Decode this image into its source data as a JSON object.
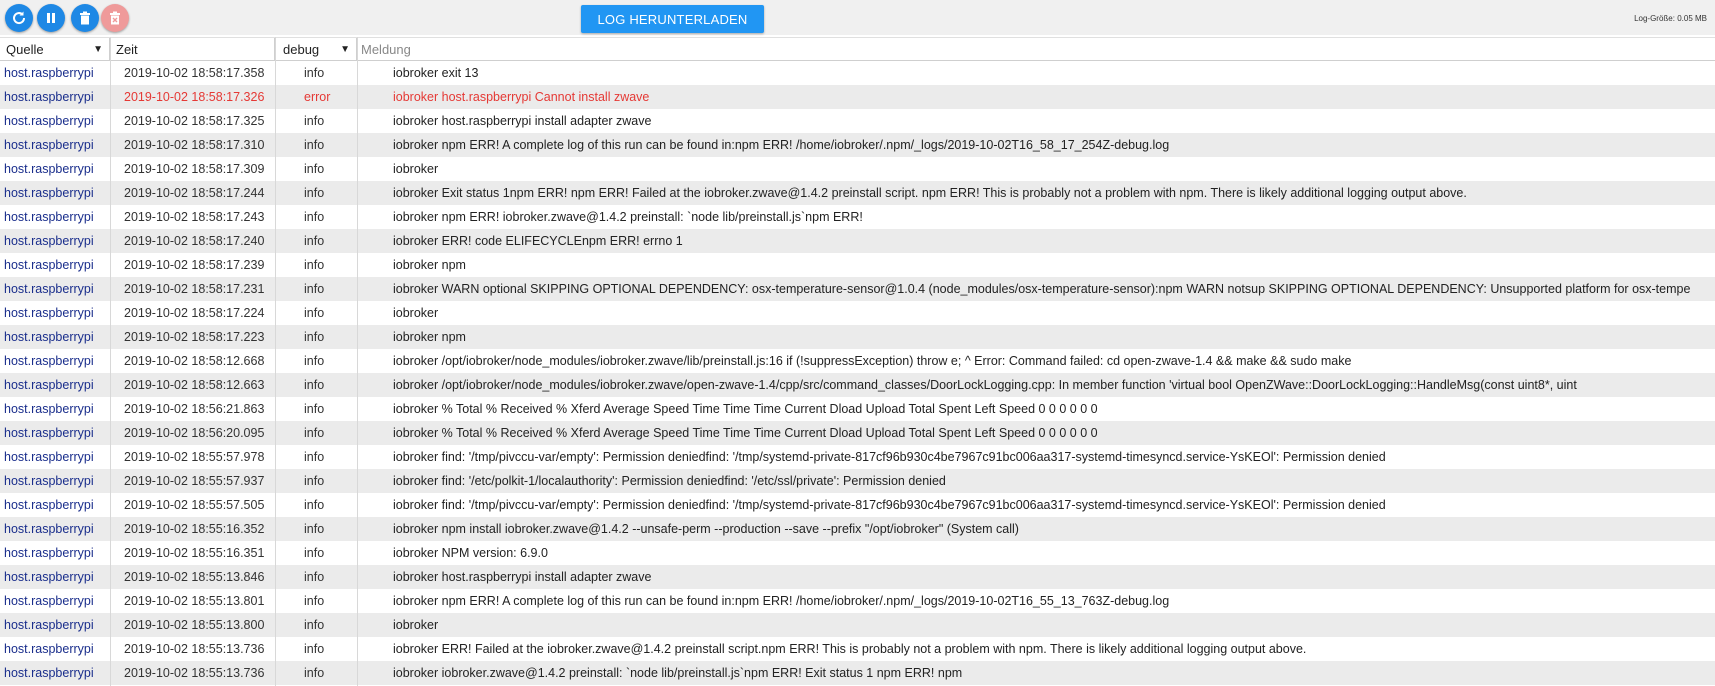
{
  "toolbar": {
    "buttons": [
      {
        "name": "refresh-button",
        "icon": "refresh-icon"
      },
      {
        "name": "pause-button",
        "icon": "pause-icon"
      },
      {
        "name": "delete-button",
        "icon": "trash-icon"
      },
      {
        "name": "delete-all-button",
        "icon": "trash-x-icon"
      }
    ],
    "download_label": "LOG HERUNTERLADEN",
    "log_size_label": "Log-Größe:",
    "log_size_value": "0.05 MB",
    "colors": {
      "primary": "#1e88e5",
      "disabled": "#ef9a9a",
      "download": "#2196f3"
    }
  },
  "table": {
    "headers": {
      "source": "Quelle",
      "time": "Zeit",
      "severity": "debug",
      "message": "Meldung"
    },
    "rows": [
      {
        "src": "host.raspberrypi",
        "time": "2019-10-02 18:58:17.358",
        "sev": "info",
        "msg": "iobroker exit 13"
      },
      {
        "src": "host.raspberrypi",
        "time": "2019-10-02 18:58:17.326",
        "sev": "error",
        "msg": "iobroker host.raspberrypi Cannot install zwave"
      },
      {
        "src": "host.raspberrypi",
        "time": "2019-10-02 18:58:17.325",
        "sev": "info",
        "msg": "iobroker host.raspberrypi install adapter zwave"
      },
      {
        "src": "host.raspberrypi",
        "time": "2019-10-02 18:58:17.310",
        "sev": "info",
        "msg": "iobroker npm ERR! A complete log of this run can be found in:npm ERR! /home/iobroker/.npm/_logs/2019-10-02T16_58_17_254Z-debug.log"
      },
      {
        "src": "host.raspberrypi",
        "time": "2019-10-02 18:58:17.309",
        "sev": "info",
        "msg": "iobroker"
      },
      {
        "src": "host.raspberrypi",
        "time": "2019-10-02 18:58:17.244",
        "sev": "info",
        "msg": "iobroker Exit status 1npm ERR! npm ERR! Failed at the iobroker.zwave@1.4.2 preinstall script. npm ERR! This is probably not a problem with npm. There is likely additional logging output above."
      },
      {
        "src": "host.raspberrypi",
        "time": "2019-10-02 18:58:17.243",
        "sev": "info",
        "msg": "iobroker npm ERR! iobroker.zwave@1.4.2 preinstall: `node lib/preinstall.js`npm ERR!"
      },
      {
        "src": "host.raspberrypi",
        "time": "2019-10-02 18:58:17.240",
        "sev": "info",
        "msg": "iobroker ERR! code ELIFECYCLEnpm ERR! errno 1"
      },
      {
        "src": "host.raspberrypi",
        "time": "2019-10-02 18:58:17.239",
        "sev": "info",
        "msg": "iobroker npm"
      },
      {
        "src": "host.raspberrypi",
        "time": "2019-10-02 18:58:17.231",
        "sev": "info",
        "msg": "iobroker WARN optional SKIPPING OPTIONAL DEPENDENCY: osx-temperature-sensor@1.0.4 (node_modules/osx-temperature-sensor):npm WARN notsup SKIPPING OPTIONAL DEPENDENCY: Unsupported platform for osx-tempe"
      },
      {
        "src": "host.raspberrypi",
        "time": "2019-10-02 18:58:17.224",
        "sev": "info",
        "msg": "iobroker"
      },
      {
        "src": "host.raspberrypi",
        "time": "2019-10-02 18:58:17.223",
        "sev": "info",
        "msg": "iobroker npm"
      },
      {
        "src": "host.raspberrypi",
        "time": "2019-10-02 18:58:12.668",
        "sev": "info",
        "msg": "iobroker /opt/iobroker/node_modules/iobroker.zwave/lib/preinstall.js:16 if (!suppressException) throw e; ^ Error: Command failed: cd open-zwave-1.4 && make && sudo make"
      },
      {
        "src": "host.raspberrypi",
        "time": "2019-10-02 18:58:12.663",
        "sev": "info",
        "msg": "iobroker /opt/iobroker/node_modules/iobroker.zwave/open-zwave-1.4/cpp/src/command_classes/DoorLockLogging.cpp: In member function 'virtual bool OpenZWave::DoorLockLogging::HandleMsg(const uint8*, uint"
      },
      {
        "src": "host.raspberrypi",
        "time": "2019-10-02 18:56:21.863",
        "sev": "info",
        "msg": "iobroker % Total % Received % Xferd Average Speed Time Time Time Current Dload Upload Total Spent Left Speed 0 0 0 0 0 0"
      },
      {
        "src": "host.raspberrypi",
        "time": "2019-10-02 18:56:20.095",
        "sev": "info",
        "msg": "iobroker % Total % Received % Xferd Average Speed Time Time Time Current Dload Upload Total Spent Left Speed 0 0 0 0 0 0"
      },
      {
        "src": "host.raspberrypi",
        "time": "2019-10-02 18:55:57.978",
        "sev": "info",
        "msg": "iobroker find: '/tmp/pivccu-var/empty': Permission deniedfind: '/tmp/systemd-private-817cf96b930c4be7967c91bc006aa317-systemd-timesyncd.service-YsKEOl': Permission denied"
      },
      {
        "src": "host.raspberrypi",
        "time": "2019-10-02 18:55:57.937",
        "sev": "info",
        "msg": "iobroker find: '/etc/polkit-1/localauthority': Permission deniedfind: '/etc/ssl/private': Permission denied"
      },
      {
        "src": "host.raspberrypi",
        "time": "2019-10-02 18:55:57.505",
        "sev": "info",
        "msg": "iobroker find: '/tmp/pivccu-var/empty': Permission deniedfind: '/tmp/systemd-private-817cf96b930c4be7967c91bc006aa317-systemd-timesyncd.service-YsKEOl': Permission denied"
      },
      {
        "src": "host.raspberrypi",
        "time": "2019-10-02 18:55:16.352",
        "sev": "info",
        "msg": "iobroker npm install iobroker.zwave@1.4.2 --unsafe-perm --production --save --prefix \"/opt/iobroker\" (System call)"
      },
      {
        "src": "host.raspberrypi",
        "time": "2019-10-02 18:55:16.351",
        "sev": "info",
        "msg": "iobroker NPM version: 6.9.0"
      },
      {
        "src": "host.raspberrypi",
        "time": "2019-10-02 18:55:13.846",
        "sev": "info",
        "msg": "iobroker host.raspberrypi install adapter zwave"
      },
      {
        "src": "host.raspberrypi",
        "time": "2019-10-02 18:55:13.801",
        "sev": "info",
        "msg": "iobroker npm ERR! A complete log of this run can be found in:npm ERR! /home/iobroker/.npm/_logs/2019-10-02T16_55_13_763Z-debug.log"
      },
      {
        "src": "host.raspberrypi",
        "time": "2019-10-02 18:55:13.800",
        "sev": "info",
        "msg": "iobroker"
      },
      {
        "src": "host.raspberrypi",
        "time": "2019-10-02 18:55:13.736",
        "sev": "info",
        "msg": "iobroker ERR! Failed at the iobroker.zwave@1.4.2 preinstall script.npm ERR! This is probably not a problem with npm. There is likely additional logging output above."
      },
      {
        "src": "host.raspberrypi",
        "time": "2019-10-02 18:55:13.736",
        "sev": "info",
        "msg": "iobroker iobroker.zwave@1.4.2 preinstall: `node lib/preinstall.js`npm ERR! Exit status 1 npm ERR! npm"
      }
    ]
  }
}
